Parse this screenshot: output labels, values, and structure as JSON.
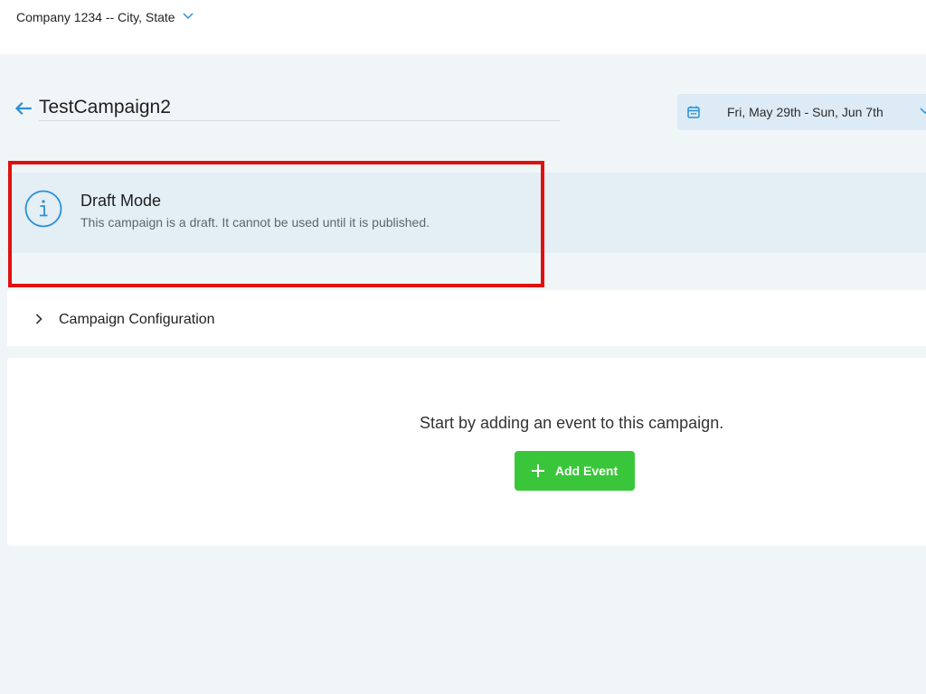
{
  "header": {
    "company": "Company 1234 -- City, State"
  },
  "campaign": {
    "title": "TestCampaign2",
    "date_range": "Fri, May 29th - Sun, Jun 7th"
  },
  "draft_notice": {
    "title": "Draft Mode",
    "description": "This campaign is a draft. It cannot be used until it is published."
  },
  "config": {
    "label": "Campaign Configuration"
  },
  "events": {
    "empty_message": "Start by adding an event to this campaign.",
    "add_label": "Add Event"
  },
  "colors": {
    "accent": "#2a8fd6",
    "highlight": "#e01010",
    "button": "#3ac63a"
  },
  "icons": {
    "back": "arrow-left-icon",
    "calendar": "calendar-icon",
    "info": "info-icon",
    "expand": "chevron-right-icon",
    "dropdown": "chevron-down-icon",
    "add": "plus-icon"
  }
}
